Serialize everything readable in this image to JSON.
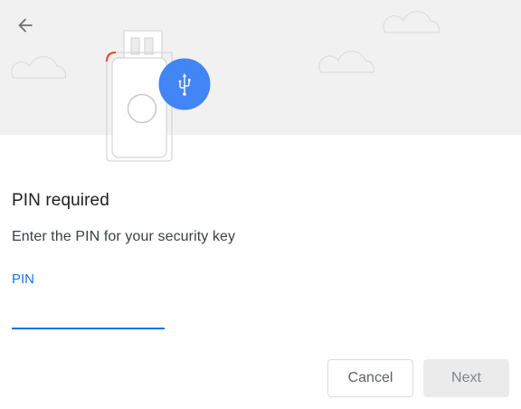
{
  "dialog": {
    "title": "PIN required",
    "description": "Enter the PIN for your security key",
    "pin_label": "PIN",
    "pin_value": "",
    "cancel_label": "Cancel",
    "next_label": "Next"
  },
  "colors": {
    "accent": "#1a73e8",
    "header_background": "#f1f1f1",
    "usb_badge": "#4285f4",
    "key_indicator": "#ea4335"
  },
  "icons": {
    "back": "arrow-back-icon",
    "usb": "usb-icon"
  }
}
